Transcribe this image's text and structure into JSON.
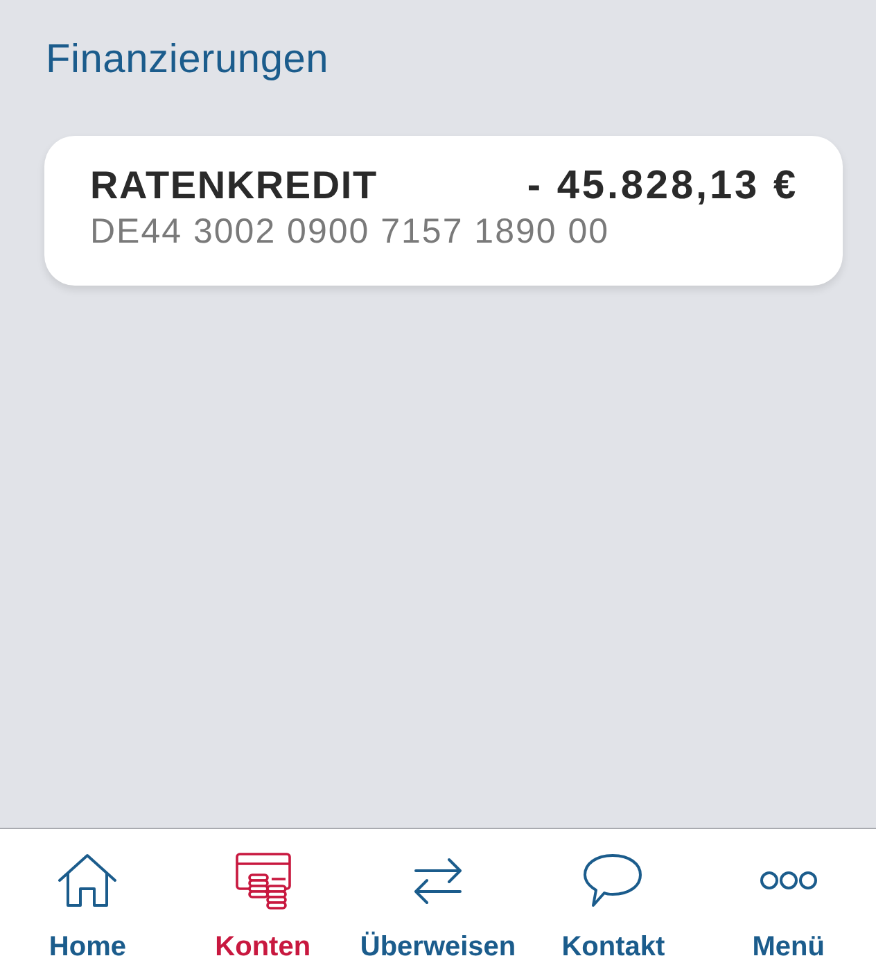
{
  "section": {
    "title": "Finanzierungen"
  },
  "accounts": [
    {
      "name": "RATENKREDIT",
      "amount": "- 45.828,13 €",
      "iban": "DE44 3002 0900 7157 1890 00"
    }
  ],
  "tab_bar": [
    {
      "kind": "home",
      "label": "Home",
      "selected": false
    },
    {
      "kind": "accounts",
      "label": "Konten",
      "selected": true
    },
    {
      "kind": "transfer",
      "label": "Überweisen",
      "selected": false
    },
    {
      "kind": "contact",
      "label": "Kontakt",
      "selected": false
    },
    {
      "kind": "more",
      "label": "Menü",
      "selected": false
    }
  ]
}
